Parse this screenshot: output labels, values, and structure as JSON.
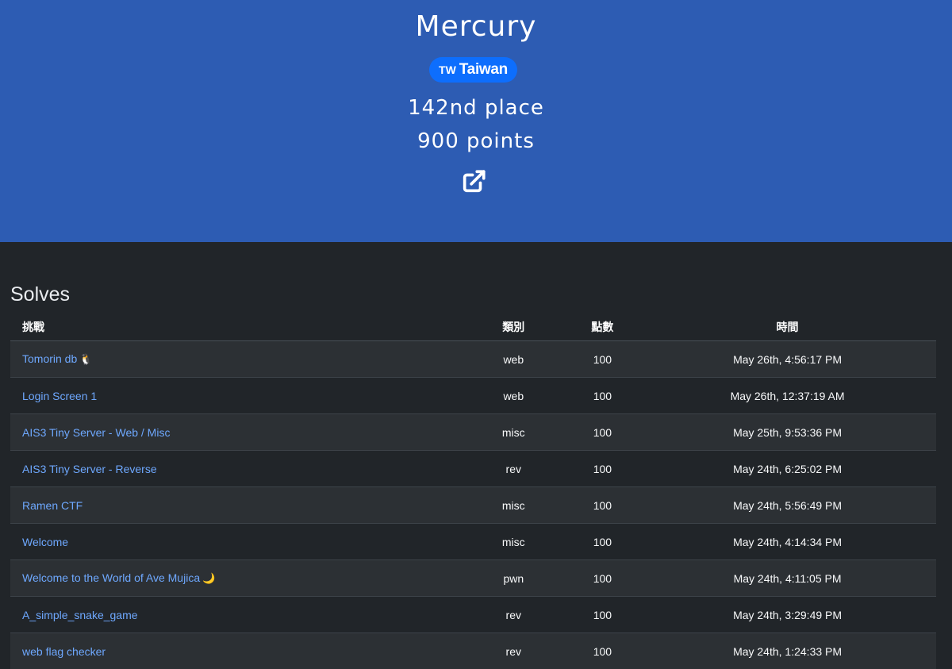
{
  "team": {
    "name": "Mercury",
    "country_code": "TW",
    "country_name": "Taiwan",
    "place": "142nd place",
    "points": "900 points"
  },
  "colors": {
    "hero_background": "#2d5cb3",
    "page_background": "#212529",
    "badge": "#0d6efd",
    "link": "#6ea8fe"
  },
  "solves": {
    "title": "Solves",
    "columns": [
      "挑戰",
      "類別",
      "點數",
      "時間"
    ],
    "rows": [
      {
        "challenge": "Tomorin db",
        "emoji": "🐧",
        "category": "web",
        "points": "100",
        "time": "May 26th, 4:56:17 PM"
      },
      {
        "challenge": "Login Screen 1",
        "emoji": "",
        "category": "web",
        "points": "100",
        "time": "May 26th, 12:37:19 AM"
      },
      {
        "challenge": "AIS3 Tiny Server - Web / Misc",
        "emoji": "",
        "category": "misc",
        "points": "100",
        "time": "May 25th, 9:53:36 PM"
      },
      {
        "challenge": "AIS3 Tiny Server - Reverse",
        "emoji": "",
        "category": "rev",
        "points": "100",
        "time": "May 24th, 6:25:02 PM"
      },
      {
        "challenge": "Ramen CTF",
        "emoji": "",
        "category": "misc",
        "points": "100",
        "time": "May 24th, 5:56:49 PM"
      },
      {
        "challenge": "Welcome",
        "emoji": "",
        "category": "misc",
        "points": "100",
        "time": "May 24th, 4:14:34 PM"
      },
      {
        "challenge": "Welcome to the World of Ave Mujica",
        "emoji": "🌙",
        "category": "pwn",
        "points": "100",
        "time": "May 24th, 4:11:05 PM"
      },
      {
        "challenge": "A_simple_snake_game",
        "emoji": "",
        "category": "rev",
        "points": "100",
        "time": "May 24th, 3:29:49 PM"
      },
      {
        "challenge": "web flag checker",
        "emoji": "",
        "category": "rev",
        "points": "100",
        "time": "May 24th, 1:24:33 PM"
      }
    ]
  },
  "icons": {
    "external_link": "external-link-icon"
  }
}
